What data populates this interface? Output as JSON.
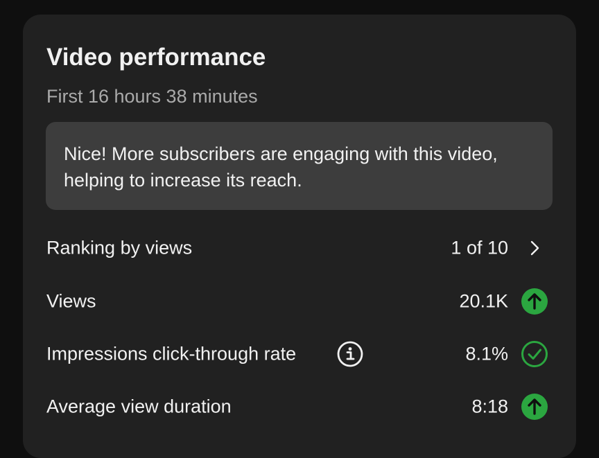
{
  "card": {
    "title": "Video performance",
    "subtitle": "First 16 hours 38 minutes",
    "callout_text": "Nice! More subscribers are engaging with this video, helping to increase its reach."
  },
  "rows": [
    {
      "label": "Ranking by views",
      "value": "1 of 10",
      "icon": "chevron-right-icon"
    },
    {
      "label": "Views",
      "value": "20.1K",
      "icon": "arrow-up-circle-icon"
    },
    {
      "label": "Impressions click-through rate",
      "value": "8.1%",
      "icon": "check-circle-icon",
      "info_icon": "info-icon"
    },
    {
      "label": "Average view duration",
      "value": "8:18",
      "icon": "arrow-up-circle-icon"
    }
  ],
  "colors": {
    "background": "#0f0f0f",
    "card": "#212121",
    "callout": "#3d3d3d",
    "text_primary": "#f1f1f1",
    "text_secondary": "#aaaaaa",
    "positive": "#2ba640"
  }
}
